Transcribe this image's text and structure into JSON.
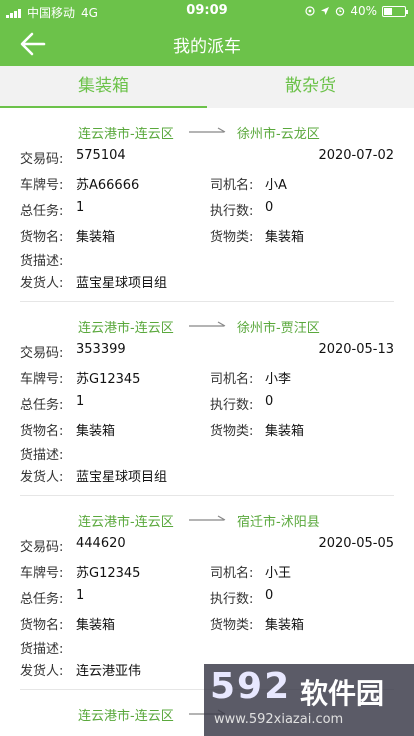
{
  "status_bar": {
    "carrier": "中国移动",
    "network": "4G",
    "time": "09:09",
    "battery_percent": "40%",
    "battery_level": 0.4
  },
  "navbar": {
    "title": "我的派车"
  },
  "tabs": [
    {
      "label": "集装箱",
      "selected": true
    },
    {
      "label": "散杂货",
      "selected": false
    }
  ],
  "labels": {
    "trade_no": "交易码:",
    "plate": "车牌号:",
    "driver": "司机名:",
    "total_tasks": "总任务:",
    "executed": "执行数:",
    "goods_name": "货物名:",
    "goods_type": "货物类:",
    "goods_desc": "货描述:",
    "shipper": "发货人:"
  },
  "orders": [
    {
      "from": "连云港市-连云区",
      "to": "徐州市-云龙区",
      "trade_no": "575104",
      "date": "2020-07-02",
      "plate": "苏A66666",
      "driver": "小A",
      "total_tasks": "1",
      "executed": "0",
      "goods_name": "集装箱",
      "goods_type": "集装箱",
      "goods_desc": "",
      "shipper": "蓝宝星球项目组"
    },
    {
      "from": "连云港市-连云区",
      "to": "徐州市-贾汪区",
      "trade_no": "353399",
      "date": "2020-05-13",
      "plate": "苏G12345",
      "driver": "小李",
      "total_tasks": "1",
      "executed": "0",
      "goods_name": "集装箱",
      "goods_type": "集装箱",
      "goods_desc": "",
      "shipper": "蓝宝星球项目组"
    },
    {
      "from": "连云港市-连云区",
      "to": "宿迁市-沭阳县",
      "trade_no": "444620",
      "date": "2020-05-05",
      "plate": "苏G12345",
      "driver": "小王",
      "total_tasks": "1",
      "executed": "0",
      "goods_name": "集装箱",
      "goods_type": "集装箱",
      "goods_desc": "",
      "shipper": "连云港亚伟"
    },
    {
      "from": "连云港市-连云区"
    }
  ],
  "watermark": {
    "big": "592",
    "cn": "软件园",
    "url": "www.592xiazai.com"
  },
  "colors": {
    "brand_green": "#6cc24a",
    "route_green": "#5aa83c"
  }
}
